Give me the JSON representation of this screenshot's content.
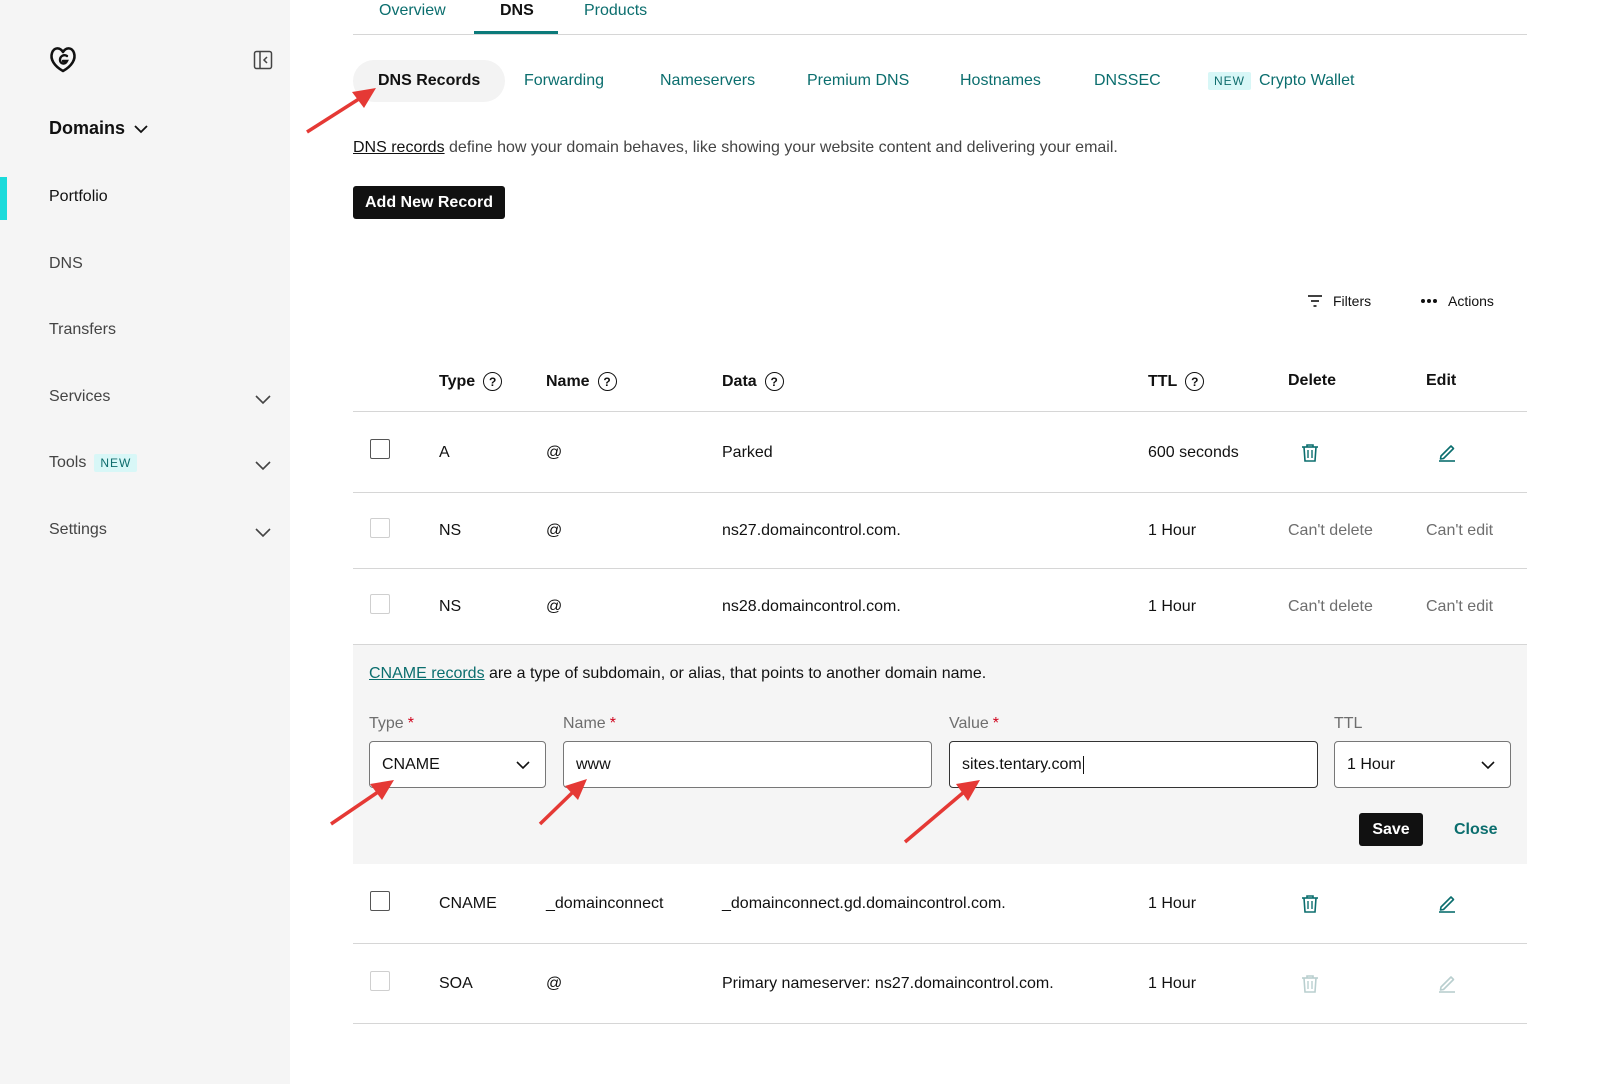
{
  "colors": {
    "accent": "#0b6e6e",
    "active_bar": "#1bdbdb",
    "arrow": "#e53935"
  },
  "sidebar": {
    "logo_icon": "godaddy-logo-icon",
    "title": "Domains",
    "items": [
      {
        "label": "Portfolio"
      },
      {
        "label": "DNS"
      },
      {
        "label": "Transfers"
      },
      {
        "label": "Services"
      },
      {
        "label": "Tools",
        "badge": "NEW"
      },
      {
        "label": "Settings"
      }
    ]
  },
  "top_tabs": [
    "Overview",
    "DNS",
    "Products"
  ],
  "sub_tabs": {
    "active": "DNS Records",
    "items": [
      "Forwarding",
      "Nameservers",
      "Premium DNS",
      "Hostnames",
      "DNSSEC"
    ],
    "crypto_badge": "NEW",
    "crypto_label": "Crypto Wallet"
  },
  "intro": {
    "link": "DNS records",
    "text": " define how your domain behaves, like showing your website content and delivering your email."
  },
  "add_button": "Add New Record",
  "toolbar": {
    "filters": "Filters",
    "actions": "Actions"
  },
  "table": {
    "headers": {
      "type": "Type",
      "name": "Name",
      "data": "Data",
      "ttl": "TTL",
      "delete": "Delete",
      "edit": "Edit"
    },
    "rows": [
      {
        "type": "A",
        "name": "@",
        "data": "Parked",
        "ttl": "600 seconds"
      },
      {
        "type": "NS",
        "name": "@",
        "data": "ns27.domaincontrol.com.",
        "ttl": "1 Hour",
        "delete": "Can't delete",
        "edit": "Can't edit"
      },
      {
        "type": "NS",
        "name": "@",
        "data": "ns28.domaincontrol.com.",
        "ttl": "1 Hour",
        "delete": "Can't delete",
        "edit": "Can't edit"
      },
      {
        "type": "CNAME",
        "name": "_domainconnect",
        "data": "_domainconnect.gd.domaincontrol.com.",
        "ttl": "1 Hour"
      },
      {
        "type": "SOA",
        "name": "@",
        "data": "Primary nameserver: ns27.domaincontrol.com.",
        "ttl": "1 Hour"
      }
    ]
  },
  "edit_panel": {
    "link": "CNAME records",
    "text": " are a type of subdomain, or alias, that points to another domain name.",
    "labels": {
      "type": "Type",
      "name": "Name",
      "value": "Value",
      "ttl": "TTL"
    },
    "required_mark": "*",
    "values": {
      "type": "CNAME",
      "name": "www",
      "value": "sites.tentary.com",
      "ttl": "1 Hour"
    },
    "save": "Save",
    "close": "Close"
  }
}
